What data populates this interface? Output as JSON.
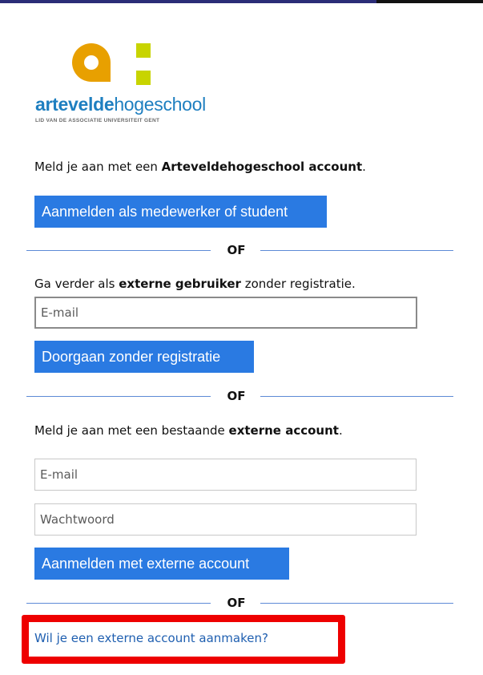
{
  "colors": {
    "accent_button": "#2a7ae2",
    "divider": "#5d8ad6",
    "link": "#1f5fb0",
    "highlight": "#ee0000",
    "logo_orange": "#e8a000",
    "logo_green": "#c8d400",
    "logo_blue": "#1e7fc0"
  },
  "logo": {
    "name_part1": "artevelde",
    "name_part2": "hogeschool",
    "tagline": "LID VAN DE ASSOCIATIE UNIVERSITEIT GENT",
    "icon": "arteveldehogeschool-logo-icon"
  },
  "section1": {
    "text_prefix": "Meld je aan met een ",
    "text_bold": "Arteveldehogeschool account",
    "text_suffix": ".",
    "button_label": "Aanmelden als medewerker of student"
  },
  "divider_label": "OF",
  "section2": {
    "text_prefix": "Ga verder als ",
    "text_bold": "externe gebruiker",
    "text_suffix": " zonder registratie.",
    "email_placeholder": "E-mail",
    "button_label": "Doorgaan zonder registratie"
  },
  "section3": {
    "text_prefix": "Meld je aan met een bestaande ",
    "text_bold": "externe account",
    "text_suffix": ".",
    "email_placeholder": "E-mail",
    "password_placeholder": "Wachtwoord",
    "button_label": "Aanmelden met externe account"
  },
  "create_account_link": "Wil je een externe account aanmaken?"
}
